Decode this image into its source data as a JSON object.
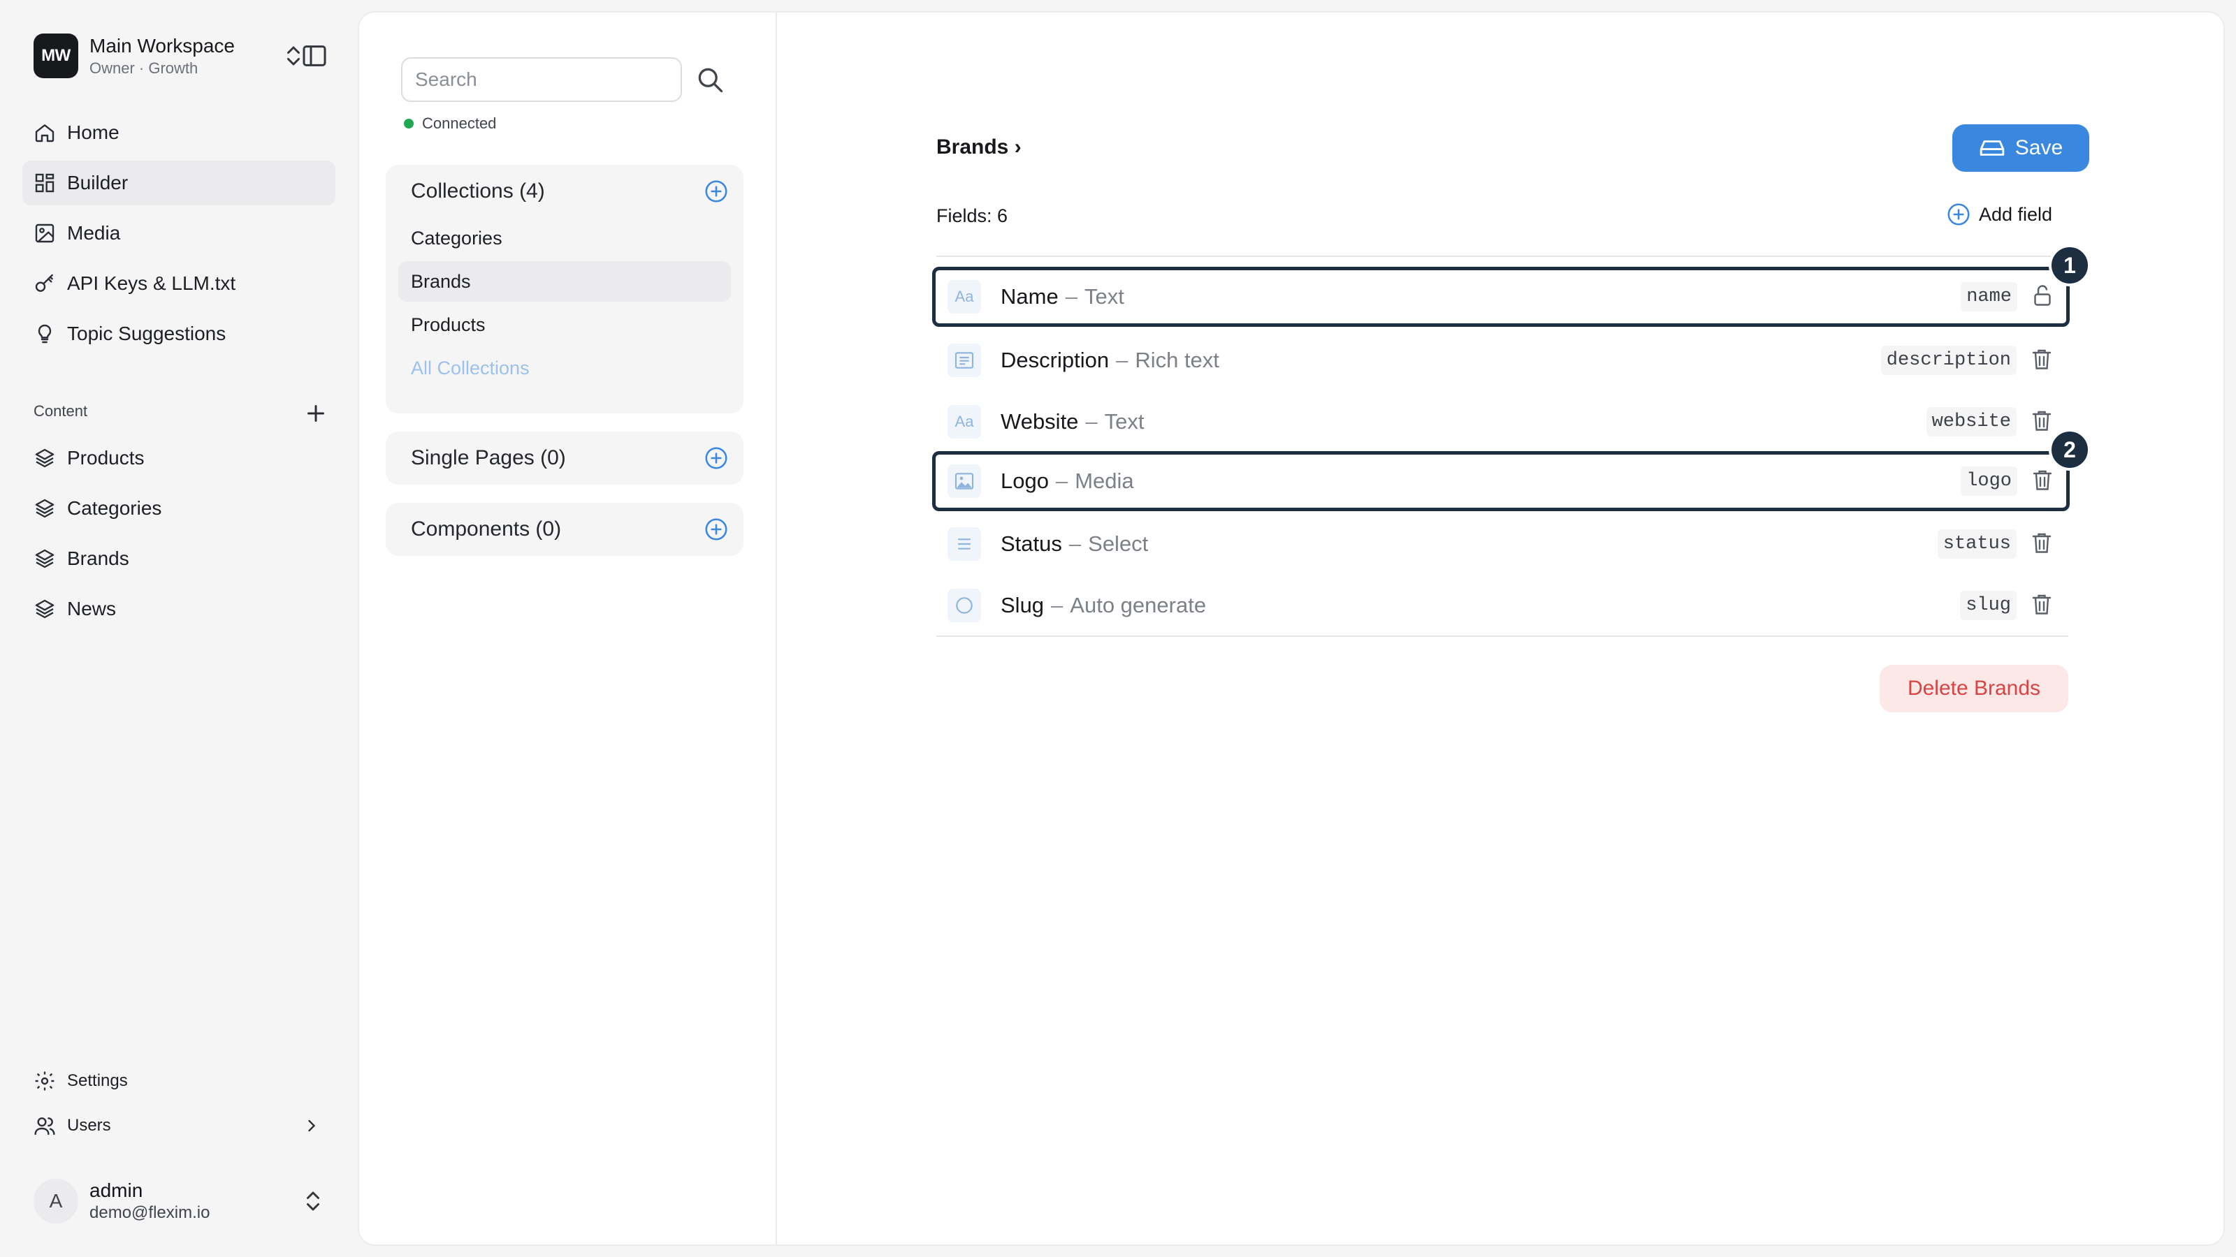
{
  "workspace": {
    "initials": "MW",
    "name": "Main Workspace",
    "subtitle": "Owner · Growth"
  },
  "sidebar": {
    "nav": [
      {
        "label": "Home",
        "icon": "home-icon"
      },
      {
        "label": "Builder",
        "icon": "grid-icon",
        "active": true
      },
      {
        "label": "Media",
        "icon": "image-icon"
      },
      {
        "label": "API Keys & LLM.txt",
        "icon": "key-icon"
      },
      {
        "label": "Topic Suggestions",
        "icon": "lightbulb-icon"
      }
    ],
    "content_label": "Content",
    "content_items": [
      {
        "label": "Products",
        "icon": "layers-icon"
      },
      {
        "label": "Categories",
        "icon": "layers-icon"
      },
      {
        "label": "Brands",
        "icon": "layers-icon"
      },
      {
        "label": "News",
        "icon": "layers-icon"
      }
    ],
    "bottom": [
      {
        "label": "Settings",
        "icon": "gear-icon"
      },
      {
        "label": "Users",
        "icon": "users-icon"
      }
    ],
    "user": {
      "initial": "A",
      "name": "admin",
      "email": "demo@flexim.io"
    }
  },
  "middle": {
    "search_placeholder": "Search",
    "status": "Connected",
    "status_color": "#1fa84f",
    "collections": {
      "title": "Collections (4)",
      "items": [
        "Categories",
        "Brands",
        "Products"
      ],
      "active": "Brands",
      "all_label": "All Collections"
    },
    "single_pages": {
      "title": "Single Pages (0)"
    },
    "components": {
      "title": "Components (0)"
    }
  },
  "editor": {
    "breadcrumb": "Brands ›",
    "save_label": "Save",
    "fields_count": "Fields: 6",
    "add_field_label": "Add field",
    "fields": [
      {
        "name": "Name",
        "type": "Text",
        "key": "name",
        "type_icon": "text-aa-icon",
        "action": "lock-icon",
        "badge": "1"
      },
      {
        "name": "Description",
        "type": "Rich text",
        "key": "description",
        "type_icon": "rich-text-icon",
        "action": "trash-icon"
      },
      {
        "name": "Website",
        "type": "Text",
        "key": "website",
        "type_icon": "text-aa-icon",
        "action": "trash-icon"
      },
      {
        "name": "Logo",
        "type": "Media",
        "key": "logo",
        "type_icon": "image-icon",
        "action": "trash-icon",
        "badge": "2"
      },
      {
        "name": "Status",
        "type": "Select",
        "key": "status",
        "type_icon": "list-icon",
        "action": "trash-icon"
      },
      {
        "name": "Slug",
        "type": "Auto generate",
        "key": "slug",
        "type_icon": "circle-icon",
        "action": "trash-icon"
      }
    ],
    "dash": "–",
    "type_label_aa": "Aa",
    "delete_label": "Delete Brands",
    "accent_color": "#3a87e0",
    "danger_color": "#d94343"
  }
}
